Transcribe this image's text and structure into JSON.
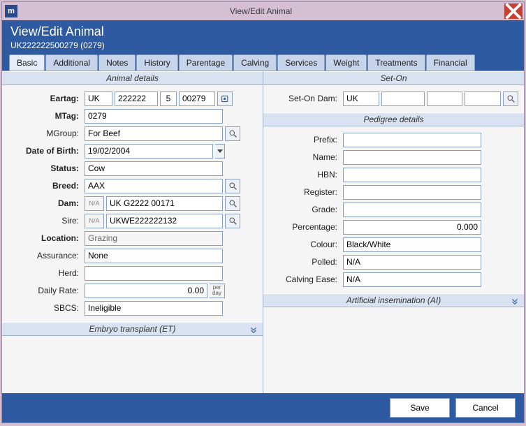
{
  "window": {
    "title": "View/Edit Animal"
  },
  "header": {
    "title": "View/Edit Animal",
    "subtitle": "UK222222500279 (0279)"
  },
  "tabs": [
    "Basic",
    "Additional",
    "Notes",
    "History",
    "Parentage",
    "Calving",
    "Services",
    "Weight",
    "Treatments",
    "Financial"
  ],
  "sections": {
    "animal_details": "Animal details",
    "et": "Embryo transplant (ET)",
    "seton": "Set-On",
    "pedigree": "Pedigree details",
    "ai": "Artificial insemination (AI)"
  },
  "labels": {
    "eartag": "Eartag:",
    "mtag": "MTag:",
    "mgroup": "MGroup:",
    "dob": "Date of Birth:",
    "status": "Status:",
    "breed": "Breed:",
    "dam": "Dam:",
    "sire": "Sire:",
    "location": "Location:",
    "assurance": "Assurance:",
    "herd": "Herd:",
    "daily": "Daily Rate:",
    "sbcs": "SBCS:",
    "seton_dam": "Set-On Dam:",
    "prefix": "Prefix:",
    "name": "Name:",
    "hbn": "HBN:",
    "register": "Register:",
    "grade": "Grade:",
    "percentage": "Percentage:",
    "colour": "Colour:",
    "polled": "Polled:",
    "calving_ease": "Calving Ease:",
    "na": "N/A",
    "perday_top": "per",
    "perday_bot": "day"
  },
  "fields": {
    "eartag": {
      "a": "UK",
      "b": "222222",
      "c": "5",
      "d": "00279"
    },
    "mtag": "0279",
    "mgroup": "For Beef",
    "dob": "19/02/2004",
    "status": "Cow",
    "breed": "AAX",
    "dam": "UK G2222 00171",
    "sire": "UKWE222222132",
    "location": "Grazing",
    "assurance": "None",
    "herd": "",
    "daily": "0.00",
    "sbcs": "Ineligible",
    "seton": {
      "a": "UK",
      "b": "",
      "c": "",
      "d": ""
    },
    "prefix": "",
    "name": "",
    "hbn": "",
    "register": "",
    "grade": "",
    "percentage": "0.000",
    "colour": "Black/White",
    "polled": "N/A",
    "calving_ease": "N/A"
  },
  "buttons": {
    "save": "Save",
    "cancel": "Cancel"
  }
}
